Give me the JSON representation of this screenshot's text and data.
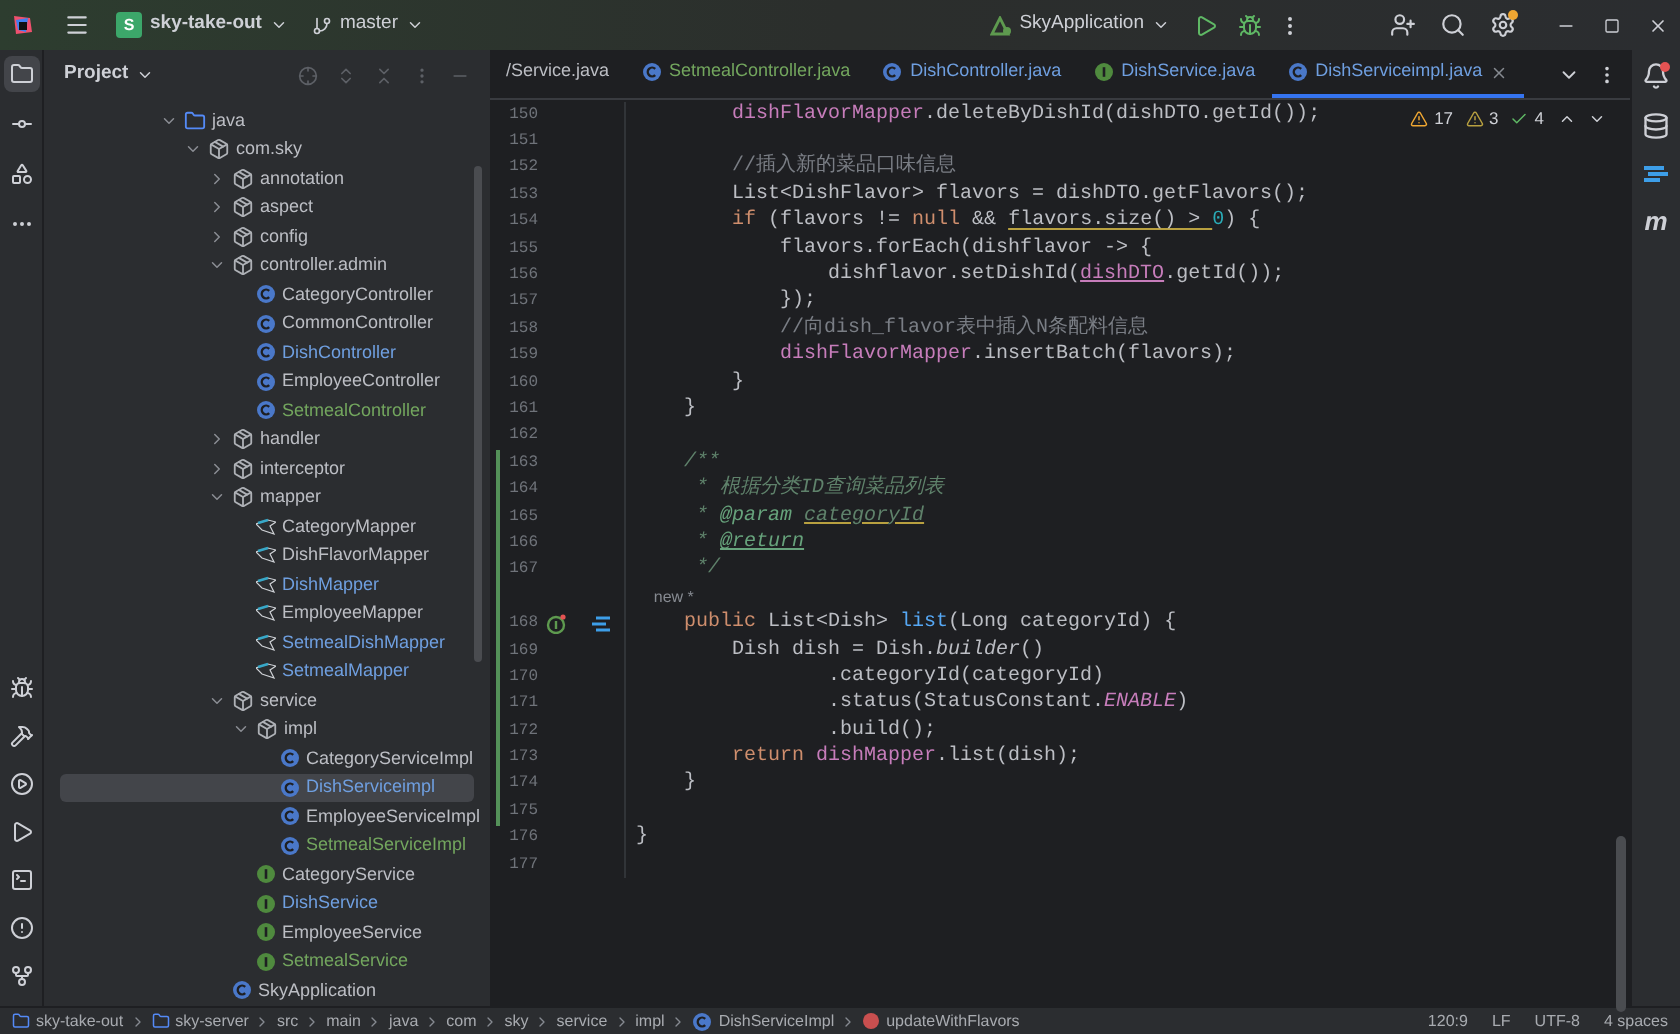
{
  "top_bar": {
    "project_badge": "S",
    "project": "sky-take-out",
    "branch": "master",
    "run_config": "SkyApplication",
    "settings_update": true
  },
  "left_tools": [
    {
      "kind": "project",
      "selected": true
    },
    {
      "kind": "commit",
      "selected": false
    },
    {
      "kind": "structure",
      "selected": false
    },
    {
      "kind": "more",
      "selected": false
    },
    {
      "kind": "debug",
      "selected": false
    },
    {
      "kind": "build",
      "selected": false
    },
    {
      "kind": "services",
      "selected": false
    },
    {
      "kind": "run",
      "selected": false
    },
    {
      "kind": "terminal",
      "selected": false
    },
    {
      "kind": "problems",
      "selected": false
    },
    {
      "kind": "git",
      "selected": false
    }
  ],
  "project_panel": {
    "title": "Project",
    "tree": [
      {
        "name": "java",
        "kind": "folder",
        "color": "#bcbec4",
        "expanded": true,
        "selected": false,
        "children": [
          {
            "name": "com.sky",
            "kind": "package",
            "color": "#bcbec4",
            "expanded": true,
            "selected": false,
            "children": [
              {
                "name": "annotation",
                "kind": "package",
                "color": "#bcbec4",
                "expanded": false,
                "selected": false
              },
              {
                "name": "aspect",
                "kind": "package",
                "color": "#bcbec4",
                "expanded": false,
                "selected": false
              },
              {
                "name": "config",
                "kind": "package",
                "color": "#bcbec4",
                "expanded": false,
                "selected": false
              },
              {
                "name": "controller.admin",
                "kind": "package",
                "color": "#bcbec4",
                "expanded": true,
                "selected": false,
                "children": [
                  {
                    "name": "CategoryController",
                    "kind": "class",
                    "color": "#bcbec4",
                    "selected": false
                  },
                  {
                    "name": "CommonController",
                    "kind": "class",
                    "color": "#bcbec4",
                    "selected": false
                  },
                  {
                    "name": "DishController",
                    "kind": "class",
                    "color": "#6f9fe0",
                    "selected": false
                  },
                  {
                    "name": "EmployeeController",
                    "kind": "class",
                    "color": "#bcbec4",
                    "selected": false
                  },
                  {
                    "name": "SetmealController",
                    "kind": "class",
                    "color": "#73a65e",
                    "selected": false
                  }
                ]
              },
              {
                "name": "handler",
                "kind": "package",
                "color": "#bcbec4",
                "expanded": false,
                "selected": false
              },
              {
                "name": "interceptor",
                "kind": "package",
                "color": "#bcbec4",
                "expanded": false,
                "selected": false
              },
              {
                "name": "mapper",
                "kind": "package",
                "color": "#bcbec4",
                "expanded": true,
                "selected": false,
                "children": [
                  {
                    "name": "CategoryMapper",
                    "kind": "mapper",
                    "color": "#bcbec4",
                    "selected": false
                  },
                  {
                    "name": "DishFlavorMapper",
                    "kind": "mapper",
                    "color": "#bcbec4",
                    "selected": false
                  },
                  {
                    "name": "DishMapper",
                    "kind": "mapper",
                    "color": "#6f9fe0",
                    "selected": false
                  },
                  {
                    "name": "EmployeeMapper",
                    "kind": "mapper",
                    "color": "#bcbec4",
                    "selected": false
                  },
                  {
                    "name": "SetmealDishMapper",
                    "kind": "mapper",
                    "color": "#6f9fe0",
                    "selected": false
                  },
                  {
                    "name": "SetmealMapper",
                    "kind": "mapper",
                    "color": "#6f9fe0",
                    "selected": false
                  }
                ]
              },
              {
                "name": "service",
                "kind": "package",
                "color": "#bcbec4",
                "expanded": true,
                "selected": false,
                "children": [
                  {
                    "name": "impl",
                    "kind": "package",
                    "color": "#bcbec4",
                    "expanded": true,
                    "selected": false,
                    "children": [
                      {
                        "name": "CategoryServiceImpl",
                        "kind": "class",
                        "color": "#bcbec4",
                        "selected": false
                      },
                      {
                        "name": "DishServiceimpl",
                        "kind": "class",
                        "color": "#6f9fe0",
                        "selected": true
                      },
                      {
                        "name": "EmployeeServiceImpl",
                        "kind": "class",
                        "color": "#bcbec4",
                        "selected": false
                      },
                      {
                        "name": "SetmealServiceImpl",
                        "kind": "class",
                        "color": "#73a65e",
                        "selected": false
                      }
                    ]
                  },
                  {
                    "name": "CategoryService",
                    "kind": "interface",
                    "color": "#bcbec4",
                    "selected": false
                  },
                  {
                    "name": "DishService",
                    "kind": "interface",
                    "color": "#6f9fe0",
                    "selected": false
                  },
                  {
                    "name": "EmployeeService",
                    "kind": "interface",
                    "color": "#bcbec4",
                    "selected": false
                  },
                  {
                    "name": "SetmealService",
                    "kind": "interface",
                    "color": "#73a65e",
                    "selected": false
                  }
                ]
              },
              {
                "name": "SkyApplication",
                "kind": "class",
                "color": "#bcbec4",
                "selected": false
              }
            ]
          }
        ]
      }
    ]
  },
  "editor": {
    "tabs": [
      {
        "label": "/Service.java",
        "kind": "plain",
        "color": "#bcbec4",
        "selected": false
      },
      {
        "label": "SetmealController.java",
        "kind": "class",
        "color": "#73a65e",
        "selected": false
      },
      {
        "label": "DishController.java",
        "kind": "class",
        "color": "#6f9fe0",
        "selected": false
      },
      {
        "label": "DishService.java",
        "kind": "interface",
        "color": "#6f9fe0",
        "selected": false
      },
      {
        "label": "DishServiceimpl.java",
        "kind": "class",
        "color": "#6f9fe0",
        "selected": true
      }
    ],
    "inspections": {
      "warnings": "17",
      "weak_warnings": "3",
      "passed": "4"
    },
    "lines": [
      {
        "kind": "code",
        "number": "150",
        "changed": false,
        "segments": [
          {
            "kind": "field",
            "text": "        dishFlavorMapper"
          },
          {
            "kind": "plain",
            "text": ".deleteByDishId(dishDTO.getId());"
          }
        ]
      },
      {
        "kind": "code",
        "number": "151",
        "changed": false
      },
      {
        "kind": "code",
        "number": "152",
        "changed": false,
        "segments": [
          {
            "kind": "comment",
            "text": "        //插入新的菜品口味信息"
          }
        ]
      },
      {
        "kind": "code",
        "number": "153",
        "changed": false,
        "segments": [
          {
            "kind": "plain",
            "text": "        List<DishFlavor> flavors = dishDTO.getFlavors();"
          }
        ]
      },
      {
        "kind": "code",
        "number": "154",
        "changed": false,
        "segments": [
          {
            "kind": "keyword",
            "text": "        if"
          },
          {
            "kind": "plain",
            "text": " (flavors != "
          },
          {
            "kind": "keyword",
            "text": "null"
          },
          {
            "kind": "plain",
            "text": " && "
          },
          {
            "kind": "warning",
            "text": "flavors.size() > "
          },
          {
            "kind": "number",
            "text": "0"
          },
          {
            "kind": "plain",
            "text": ") {"
          }
        ]
      },
      {
        "kind": "code",
        "number": "155",
        "changed": false,
        "segments": [
          {
            "kind": "plain",
            "text": "            flavors.forEach(dishflavor -> {"
          }
        ]
      },
      {
        "kind": "code",
        "number": "156",
        "changed": false,
        "segments": [
          {
            "kind": "plain",
            "text": "                dishflavor.setDishId("
          },
          {
            "kind": "field_underlined",
            "text": "dishDTO"
          },
          {
            "kind": "plain",
            "text": ".getId());"
          }
        ]
      },
      {
        "kind": "code",
        "number": "157",
        "changed": false,
        "segments": [
          {
            "kind": "plain",
            "text": "            });"
          }
        ]
      },
      {
        "kind": "code",
        "number": "158",
        "changed": false,
        "segments": [
          {
            "kind": "comment",
            "text": "            //向dish_flavor表中插入N条配料信息"
          }
        ]
      },
      {
        "kind": "code",
        "number": "159",
        "changed": false,
        "segments": [
          {
            "kind": "field",
            "text": "            dishFlavorMapper"
          },
          {
            "kind": "plain",
            "text": ".insertBatch(flavors);"
          }
        ]
      },
      {
        "kind": "code",
        "number": "160",
        "changed": false,
        "segments": [
          {
            "kind": "plain",
            "text": "        }"
          }
        ]
      },
      {
        "kind": "code",
        "number": "161",
        "changed": false,
        "segments": [
          {
            "kind": "plain",
            "text": "    }"
          }
        ]
      },
      {
        "kind": "code",
        "number": "162",
        "changed": false
      },
      {
        "kind": "code",
        "number": "163",
        "changed": true,
        "segments": [
          {
            "kind": "doc",
            "text": "    /**"
          }
        ]
      },
      {
        "kind": "code",
        "number": "164",
        "changed": true,
        "segments": [
          {
            "kind": "doc",
            "text": "     * 根据分类ID查询菜品列表"
          }
        ]
      },
      {
        "kind": "code",
        "number": "165",
        "changed": true,
        "segments": [
          {
            "kind": "doc",
            "text": "     * "
          },
          {
            "kind": "doc_tag",
            "text": "@param "
          },
          {
            "kind": "doc_param",
            "text": "categoryId"
          }
        ]
      },
      {
        "kind": "code",
        "number": "166",
        "changed": true,
        "segments": [
          {
            "kind": "doc",
            "text": "     * "
          },
          {
            "kind": "doc_tag_underlined",
            "text": "@return"
          }
        ]
      },
      {
        "kind": "code",
        "number": "167",
        "changed": true,
        "segments": [
          {
            "kind": "doc",
            "text": "     */"
          }
        ]
      },
      {
        "kind": "hint",
        "text": "new *",
        "changed": true
      },
      {
        "kind": "code",
        "number": "168",
        "changed": true,
        "gutter_icons": [
          {
            "kind": "implementation"
          },
          {
            "kind": "method-link"
          }
        ],
        "segments": [
          {
            "kind": "keyword",
            "text": "    public"
          },
          {
            "kind": "plain",
            "text": " List<Dish> "
          },
          {
            "kind": "method",
            "text": "list"
          },
          {
            "kind": "plain",
            "text": "(Long categoryId) {"
          }
        ]
      },
      {
        "kind": "code",
        "number": "169",
        "changed": true,
        "segments": [
          {
            "kind": "plain",
            "text": "        Dish dish = Dish."
          },
          {
            "kind": "italic",
            "text": "builder"
          },
          {
            "kind": "plain",
            "text": "()"
          }
        ]
      },
      {
        "kind": "code",
        "number": "170",
        "changed": true,
        "segments": [
          {
            "kind": "plain",
            "text": "                .categoryId(categoryId)"
          }
        ]
      },
      {
        "kind": "code",
        "number": "171",
        "changed": true,
        "segments": [
          {
            "kind": "plain",
            "text": "                .status(StatusConstant."
          },
          {
            "kind": "constant",
            "text": "ENABLE"
          },
          {
            "kind": "plain",
            "text": ")"
          }
        ]
      },
      {
        "kind": "code",
        "number": "172",
        "changed": true,
        "segments": [
          {
            "kind": "plain",
            "text": "                .build();"
          }
        ]
      },
      {
        "kind": "code",
        "number": "173",
        "changed": true,
        "segments": [
          {
            "kind": "keyword",
            "text": "        return "
          },
          {
            "kind": "field",
            "text": "dishMapper"
          },
          {
            "kind": "plain",
            "text": ".list(dish);"
          }
        ]
      },
      {
        "kind": "code",
        "number": "174",
        "changed": true,
        "segments": [
          {
            "kind": "plain",
            "text": "    }"
          }
        ]
      },
      {
        "kind": "code",
        "number": "175",
        "changed": true
      },
      {
        "kind": "code",
        "number": "176",
        "changed": false,
        "segments": [
          {
            "kind": "plain",
            "text": "}"
          }
        ]
      },
      {
        "kind": "code",
        "number": "177",
        "changed": false
      }
    ]
  },
  "right_tools": [
    {
      "kind": "notifications",
      "unread": true
    },
    {
      "kind": "database",
      "unread": false
    },
    {
      "kind": "assistant",
      "unread": false
    },
    {
      "kind": "maven",
      "label": "m",
      "unread": false
    }
  ],
  "status_bar": {
    "breadcrumbs": [
      {
        "label": "sky-take-out",
        "kind": "module"
      },
      {
        "label": "sky-server",
        "kind": "module"
      },
      {
        "label": "src",
        "kind": "folder"
      },
      {
        "label": "main",
        "kind": "folder"
      },
      {
        "label": "java",
        "kind": "folder"
      },
      {
        "label": "com",
        "kind": "folder"
      },
      {
        "label": "sky",
        "kind": "folder"
      },
      {
        "label": "service",
        "kind": "folder"
      },
      {
        "label": "impl",
        "kind": "folder"
      },
      {
        "label": "DishServiceImpl",
        "kind": "class"
      },
      {
        "label": "updateWithFlavors",
        "kind": "method"
      }
    ],
    "position": "120:9",
    "line_separator": "LF",
    "encoding": "UTF-8",
    "indent": "4 spaces"
  }
}
